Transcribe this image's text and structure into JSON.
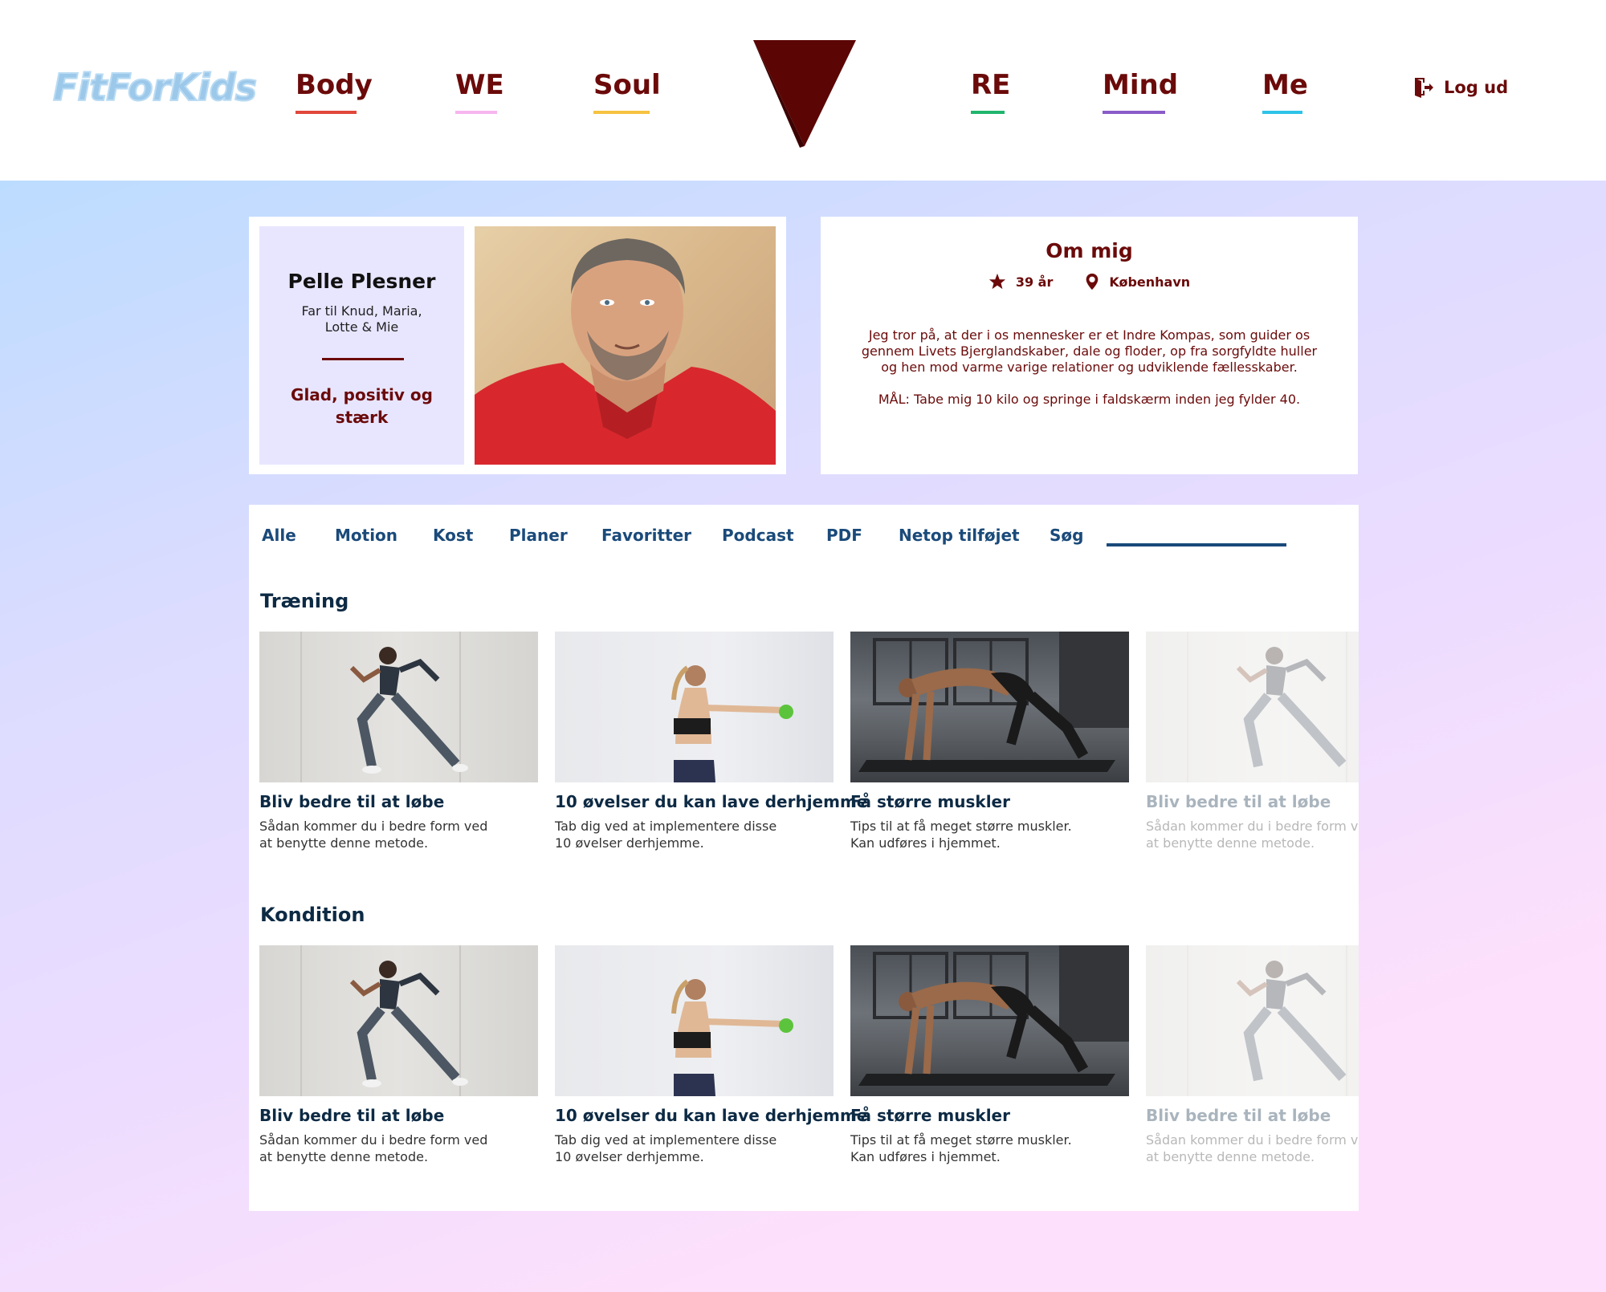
{
  "header": {
    "logo": "FitForKids",
    "nav_left": [
      {
        "label": "Body",
        "color": "#e0473a"
      },
      {
        "label": "WE",
        "color": "#f7b6ef"
      },
      {
        "label": "Soul",
        "color": "#f5c341"
      }
    ],
    "nav_right": [
      {
        "label": "RE",
        "color": "#21b56d"
      },
      {
        "label": "Mind",
        "color": "#8a5cc9"
      },
      {
        "label": "Me",
        "color": "#2ec3e8"
      }
    ],
    "logout_label": "Log ud",
    "brand_color": "#6b0a0a"
  },
  "profile": {
    "name": "Pelle Plesner",
    "family": "Far til Knud, Maria, Lotte & Mie",
    "mood": "Glad, positiv og stærk"
  },
  "about": {
    "title": "Om mig",
    "age": "39 år",
    "city": "København",
    "text": "Jeg tror på, at der i os mennesker er et Indre Kompas, som guider os gennem Livets Bjerglandskaber, dale og floder, op fra sorgfyldte huller og hen mod varme varige relationer og udviklende fællesskaber.",
    "goal": "MÅL: Tabe mig 10 kilo og springe i faldskærm inden jeg fylder 40."
  },
  "tabs": [
    "Alle",
    "Motion",
    "Kost",
    "Planer",
    "Favoritter",
    "Podcast",
    "PDF",
    "Netop tilføjet",
    "Søg"
  ],
  "sections": [
    {
      "title": "Træning",
      "cards": [
        {
          "title": "Bliv bedre til at løbe",
          "desc": "Sådan kommer du i bedre form ved at benytte denne metode."
        },
        {
          "title": "10 øvelser du kan lave derhjemme",
          "desc": "Tab dig ved at implementere disse 10 øvelser derhjemme."
        },
        {
          "title": "Få større muskler",
          "desc": "Tips til at få meget større muskler. Kan udføres i hjemmet."
        },
        {
          "title": "Bliv bedre til at løbe",
          "desc": "Sådan kommer du i bedre form ved at benytte denne metode."
        }
      ]
    },
    {
      "title": "Kondition",
      "cards": [
        {
          "title": "Bliv bedre til at løbe",
          "desc": "Sådan kommer du i bedre form ved at benytte denne metode."
        },
        {
          "title": "10 øvelser du kan lave derhjemme",
          "desc": "Tab dig ved at implementere disse 10 øvelser derhjemme."
        },
        {
          "title": "Få større muskler",
          "desc": "Tips til at få meget større muskler. Kan udføres i hjemmet."
        },
        {
          "title": "Bliv bedre til at løbe",
          "desc": "Sådan kommer du i bedre form ved at benytte denne metode."
        }
      ]
    }
  ]
}
